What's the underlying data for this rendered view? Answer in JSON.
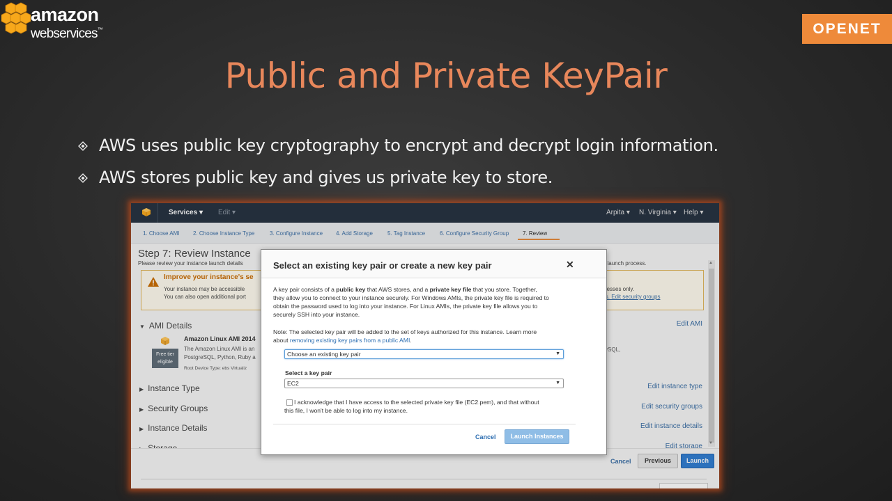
{
  "slide": {
    "logo": {
      "word1": "amazon",
      "word2": "webservices",
      "tm": "™"
    },
    "partner_logo": "OPENET",
    "title": "Public and Private KeyPair",
    "bullets": [
      "AWS uses public key cryptography to encrypt and decrypt login information.",
      "AWS stores public key and gives us private key to store."
    ],
    "colors": {
      "title": "#e8875b",
      "partner_bg": "#ee8a3a",
      "background": "#2a2a2a"
    }
  },
  "console": {
    "nav": {
      "services": "Services",
      "edit": "Edit",
      "user": "Arpita",
      "region": "N. Virginia",
      "help": "Help",
      "caret": "▾"
    },
    "steps": [
      "1. Choose AMI",
      "2. Choose Instance Type",
      "3. Configure Instance",
      "4. Add Storage",
      "5. Tag Instance",
      "6. Configure Security Group",
      "7. Review"
    ],
    "page_title": "Step 7: Review Instance",
    "page_sub": "Please review your instance launch details",
    "page_sub_right": "lete the launch process.",
    "warning": {
      "title": "Improve your instance's se",
      "line1": "Your instance may be accessible",
      "line2": "You can also open additional port",
      "right1": "ddresses only.",
      "right2": "rvers. Edit security groups"
    },
    "ami": {
      "heading": "AMI Details",
      "edit": "Edit AMI",
      "name": "Amazon Linux AMI 2014",
      "desc1": "The Amazon Linux AMI is an",
      "desc2": "PostgreSQL, Python, Ruby a",
      "desc3": "Root Device Type: ebs    Virtualiz",
      "desc_right": "che, MySQL,",
      "badge_line1": "Free tier",
      "badge_line2": "eligible"
    },
    "sections": [
      {
        "label": "Instance Type",
        "edit": "Edit instance type"
      },
      {
        "label": "Security Groups",
        "edit": "Edit security groups"
      },
      {
        "label": "Instance Details",
        "edit": "Edit instance details"
      },
      {
        "label": "Storage",
        "edit": "Edit storage"
      }
    ],
    "buttons": {
      "cancel": "Cancel",
      "previous": "Previous",
      "launch": "Launch"
    }
  },
  "modal": {
    "title": "Select an existing key pair or create a new key pair",
    "close": "✕",
    "para": {
      "l1a": "A key pair consists of a ",
      "l1b": "public key",
      "l1c": " that AWS stores, and a ",
      "l1d": "private key file",
      "l1e": " that you store. Together,",
      "l2": "they allow you to connect to your instance securely. For Windows AMIs, the private key file is required to",
      "l3": "obtain the password used to log into your instance. For Linux AMIs, the private key file allows you to",
      "l4": "securely SSH into your instance."
    },
    "note": {
      "l1": "Note: The selected key pair will be added to the set of keys authorized for this instance. Learn more",
      "l2a": "about ",
      "l2b": "removing existing key pairs from a public AMI",
      "l2c": "."
    },
    "select_mode": "Choose an existing key pair",
    "keypair_label": "Select a key pair",
    "keypair_value": "EC2",
    "caret": "▼",
    "ack1": "I acknowledge that I have access to the selected private key file (EC2.pem), and that without",
    "ack2": "this file, I won't be able to log into my instance.",
    "acknowledged": false,
    "cancel": "Cancel",
    "launch": "Launch Instances"
  }
}
